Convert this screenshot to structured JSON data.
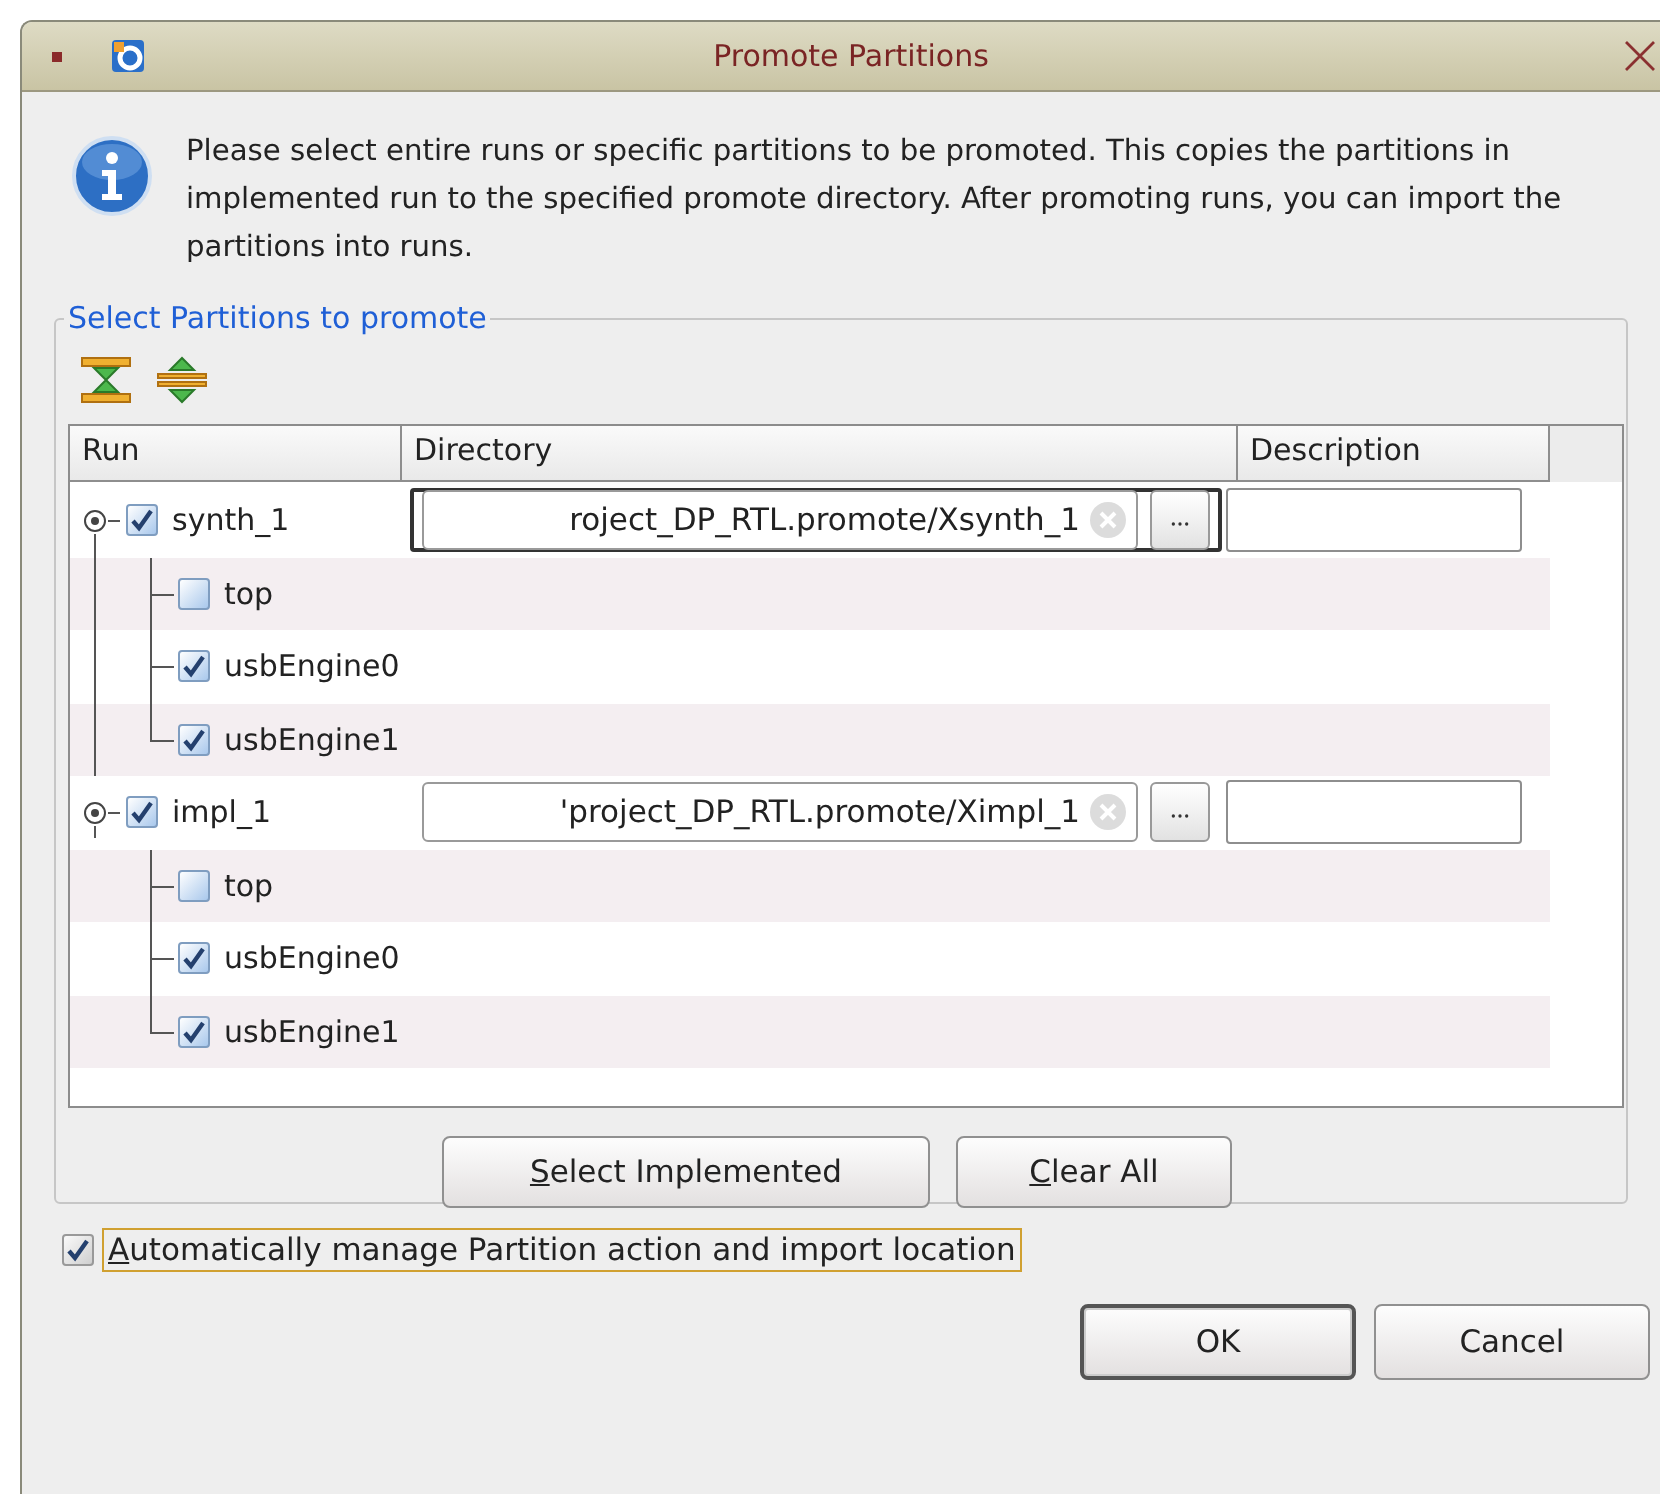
{
  "window": {
    "title": "Promote Partitions"
  },
  "info_message": "Please select entire runs or specific partitions to be promoted. This copies the partitions in implemented run to the specified promote directory. After promoting runs, you can import the partitions into runs.",
  "group": {
    "title": "Select Partitions to promote"
  },
  "table": {
    "columns": [
      "Run",
      "Directory",
      "Description"
    ],
    "runs": [
      {
        "name": "synth_1",
        "checked": true,
        "expanded": true,
        "focused": true,
        "directory": "roject_DP_RTL.promote/Xsynth_1",
        "children": [
          {
            "name": "top",
            "checked": false
          },
          {
            "name": "usbEngine0",
            "checked": true
          },
          {
            "name": "usbEngine1",
            "checked": true
          }
        ]
      },
      {
        "name": "impl_1",
        "checked": true,
        "expanded": true,
        "focused": false,
        "directory": "'project_DP_RTL.promote/Ximpl_1",
        "children": [
          {
            "name": "top",
            "checked": false
          },
          {
            "name": "usbEngine0",
            "checked": true
          },
          {
            "name": "usbEngine1",
            "checked": true
          }
        ]
      }
    ]
  },
  "table_buttons": [
    "Select Implemented",
    "Clear All"
  ],
  "auto_manage": {
    "label": "Automatically manage Partition action and import location",
    "checked": true,
    "focused": true
  },
  "dialog_buttons": [
    {
      "label": "OK",
      "default": true
    },
    {
      "label": "Cancel",
      "default": false
    }
  ]
}
